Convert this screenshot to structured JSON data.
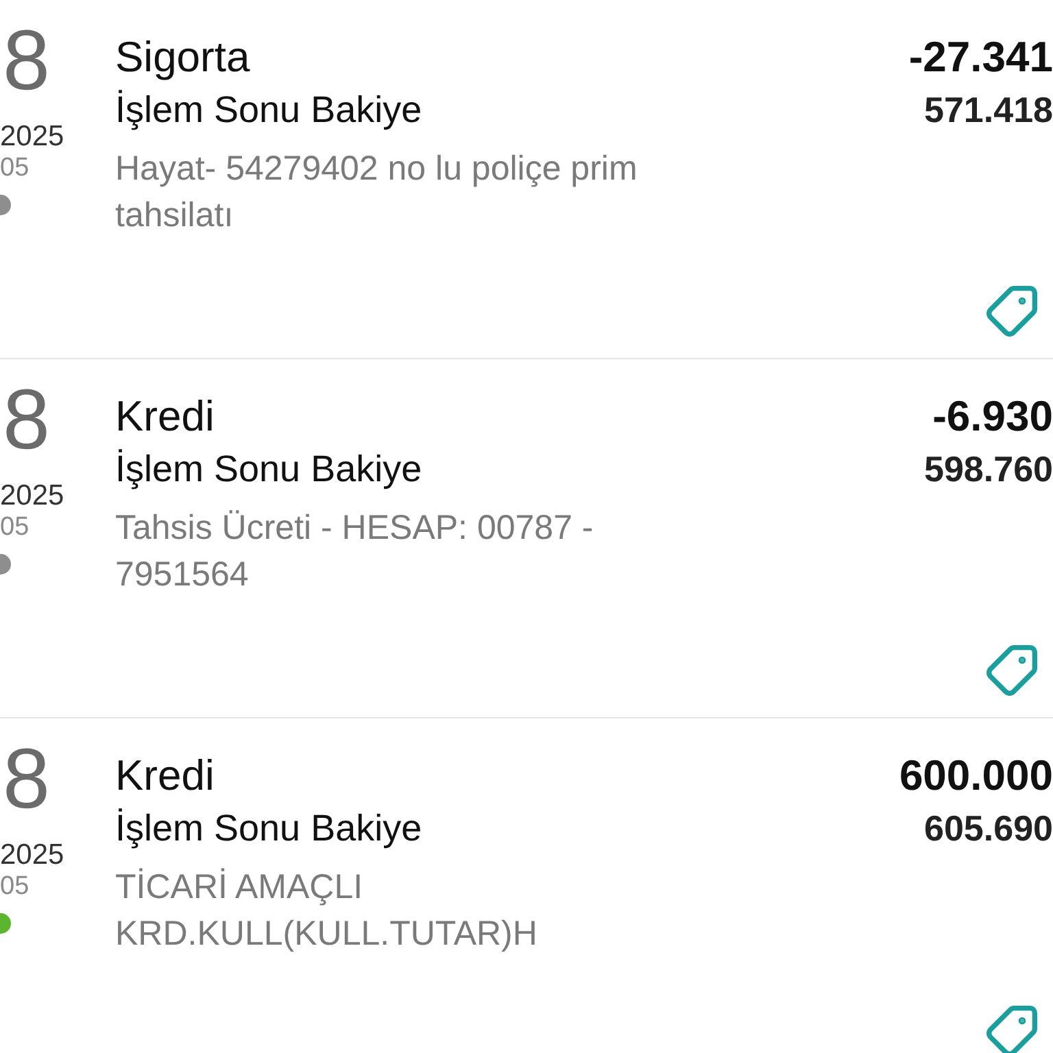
{
  "transactions": [
    {
      "day": "8",
      "year": "2025",
      "time": "05",
      "color": "#8e8e8e",
      "category": "Sigorta",
      "balance_label": "İşlem Sonu Bakiye",
      "description": "Hayat- 54279402 no lu poliçe prim tahsilatı",
      "amount": "-27.341",
      "balance": "571.418"
    },
    {
      "day": "8",
      "year": "2025",
      "time": "05",
      "color": "#8e8e8e",
      "category": "Kredi",
      "balance_label": "İşlem Sonu Bakiye",
      "description": "Tahsis Ücreti - HESAP: 00787 - 7951564",
      "amount": "-6.930",
      "balance": "598.760"
    },
    {
      "day": "8",
      "year": "2025",
      "time": "05",
      "color": "#5bb52f",
      "category": "Kredi",
      "balance_label": "İşlem Sonu Bakiye",
      "description": "TİCARİ AMAÇLI KRD.KULL(KULL.TUTAR)H",
      "amount": "600.000",
      "balance": "605.690"
    }
  ]
}
